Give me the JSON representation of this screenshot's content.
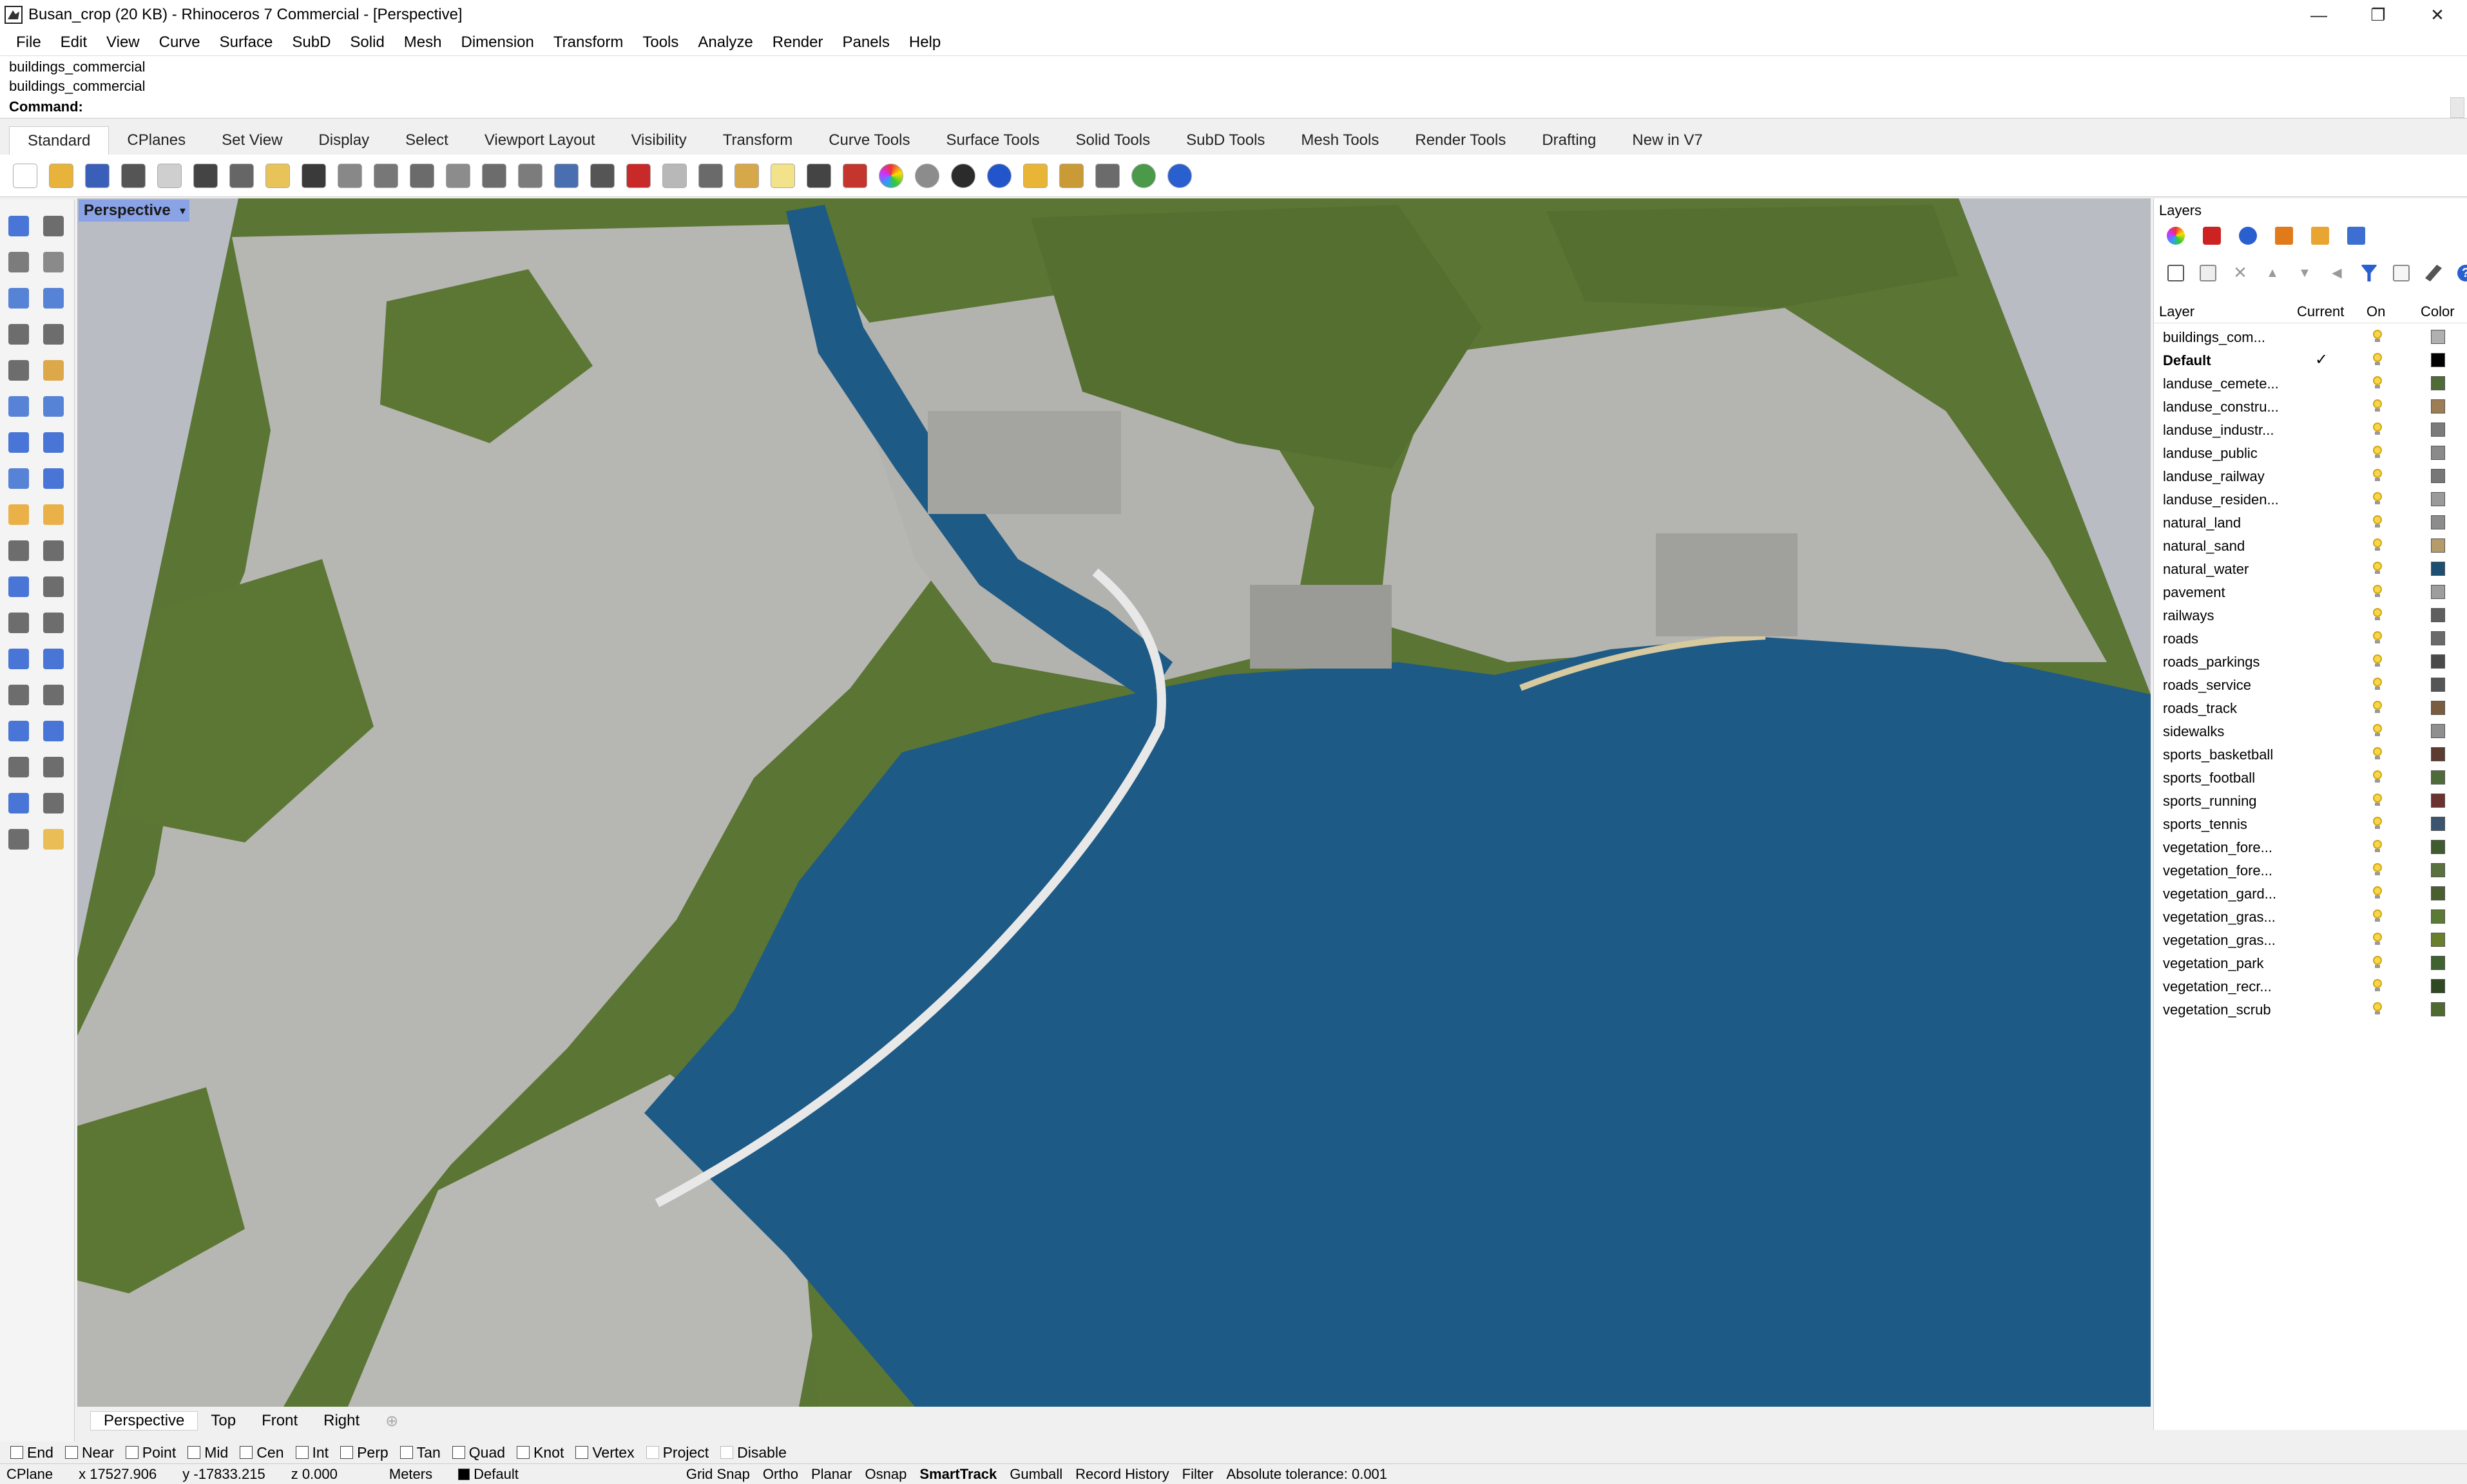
{
  "window": {
    "title": "Busan_crop (20 KB) - Rhinoceros 7 Commercial - [Perspective]",
    "minimize": "—",
    "maximize": "❐",
    "close": "✕"
  },
  "menu": [
    "File",
    "Edit",
    "View",
    "Curve",
    "Surface",
    "SubD",
    "Solid",
    "Mesh",
    "Dimension",
    "Transform",
    "Tools",
    "Analyze",
    "Render",
    "Panels",
    "Help"
  ],
  "command": {
    "history": [
      "buildings_commercial",
      "buildings_commercial"
    ],
    "prompt": "Command:",
    "value": ""
  },
  "toolbar_tabs": [
    "Standard",
    "CPlanes",
    "Set View",
    "Display",
    "Select",
    "Viewport Layout",
    "Visibility",
    "Transform",
    "Curve Tools",
    "Surface Tools",
    "Solid Tools",
    "SubD Tools",
    "Mesh Tools",
    "Render Tools",
    "Drafting",
    "New in V7"
  ],
  "toolbar_icons": [
    "new-file-icon",
    "open-file-icon",
    "save-icon",
    "print-icon",
    "import-icon",
    "cut-icon",
    "copy-icon",
    "paste-icon",
    "undo-icon",
    "pan-icon",
    "rotate-view-icon",
    "zoom-icon",
    "zoom-window-icon",
    "zoom-extents-icon",
    "zoom-selected-icon",
    "undo-view-icon",
    "four-viewports-icon",
    "car-icon",
    "tilt-icon",
    "properties-icon",
    "select-filter-icon",
    "light-icon",
    "lock-icon",
    "layer-icon",
    "color-wheel-icon",
    "shade-icon",
    "render-preview-icon",
    "render-icon",
    "named-view-icon",
    "options-icon",
    "grid-icon",
    "globe-icon",
    "help-icon"
  ],
  "viewport": {
    "label": "Perspective",
    "tabs": [
      "Perspective",
      "Top",
      "Front",
      "Right"
    ]
  },
  "layers_panel": {
    "title": "Layers",
    "columns": {
      "layer": "Layer",
      "current": "Current",
      "on": "On",
      "color": "Color"
    },
    "layers": [
      {
        "name": "buildings_com...",
        "current": "",
        "color": "#b0b0b0"
      },
      {
        "name": "Default",
        "current": "✓",
        "color": "#000000"
      },
      {
        "name": "landuse_cemete...",
        "current": "",
        "color": "#4f6b3a"
      },
      {
        "name": "landuse_constru...",
        "current": "",
        "color": "#9c7d55"
      },
      {
        "name": "landuse_industr...",
        "current": "",
        "color": "#7b7b7b"
      },
      {
        "name": "landuse_public",
        "current": "",
        "color": "#8a8a8a"
      },
      {
        "name": "landuse_railway",
        "current": "",
        "color": "#777777"
      },
      {
        "name": "landuse_residen...",
        "current": "",
        "color": "#9a9a9a"
      },
      {
        "name": "natural_land",
        "current": "",
        "color": "#8c8c8c"
      },
      {
        "name": "natural_sand",
        "current": "",
        "color": "#b59a6a"
      },
      {
        "name": "natural_water",
        "current": "",
        "color": "#1c4f72"
      },
      {
        "name": "pavement",
        "current": "",
        "color": "#9d9d9d"
      },
      {
        "name": "railways",
        "current": "",
        "color": "#5f5f5f"
      },
      {
        "name": "roads",
        "current": "",
        "color": "#6a6a6a"
      },
      {
        "name": "roads_parkings",
        "current": "",
        "color": "#4a4a4a"
      },
      {
        "name": "roads_service",
        "current": "",
        "color": "#555555"
      },
      {
        "name": "roads_track",
        "current": "",
        "color": "#7a5d40"
      },
      {
        "name": "sidewalks",
        "current": "",
        "color": "#8f8f8f"
      },
      {
        "name": "sports_basketball",
        "current": "",
        "color": "#5e3b30"
      },
      {
        "name": "sports_football",
        "current": "",
        "color": "#4f6b3a"
      },
      {
        "name": "sports_running",
        "current": "",
        "color": "#6b3330"
      },
      {
        "name": "sports_tennis",
        "current": "",
        "color": "#3b5470"
      },
      {
        "name": "vegetation_fore...",
        "current": "",
        "color": "#3f5c2f"
      },
      {
        "name": "vegetation_fore...",
        "current": "",
        "color": "#58713e"
      },
      {
        "name": "vegetation_gard...",
        "current": "",
        "color": "#4a5f30"
      },
      {
        "name": "vegetation_gras...",
        "current": "",
        "color": "#5a7a35"
      },
      {
        "name": "vegetation_gras...",
        "current": "",
        "color": "#6a7f2e"
      },
      {
        "name": "vegetation_park",
        "current": "",
        "color": "#3f6230"
      },
      {
        "name": "vegetation_recr...",
        "current": "",
        "color": "#2f4a22"
      },
      {
        "name": "vegetation_scrub",
        "current": "",
        "color": "#4f6a30"
      }
    ]
  },
  "osnap": [
    {
      "label": "End",
      "checked": false
    },
    {
      "label": "Near",
      "checked": false
    },
    {
      "label": "Point",
      "checked": false
    },
    {
      "label": "Mid",
      "checked": false
    },
    {
      "label": "Cen",
      "checked": false
    },
    {
      "label": "Int",
      "checked": false
    },
    {
      "label": "Perp",
      "checked": false
    },
    {
      "label": "Tan",
      "checked": false
    },
    {
      "label": "Quad",
      "checked": false
    },
    {
      "label": "Knot",
      "checked": false
    },
    {
      "label": "Vertex",
      "checked": false
    },
    {
      "label": "Project",
      "checked": false
    },
    {
      "label": "Disable",
      "checked": false
    }
  ],
  "status": {
    "cplane": "CPlane",
    "x": "x 17527.906",
    "y": "y -17833.215",
    "z": "z 0.000",
    "units": "Meters",
    "layer": "Default",
    "layer_color": "#000000",
    "toggles": [
      "Grid Snap",
      "Ortho",
      "Planar",
      "Osnap",
      "SmartTrack",
      "Gumball",
      "Record History",
      "Filter"
    ],
    "active_toggle": "SmartTrack",
    "tolerance": "Absolute tolerance: 0.001"
  },
  "colors": {
    "water": "#1d5a85",
    "terrain_green": "#5a7534",
    "city_gray": "#b6b6b2",
    "viewport_bg": "#b9bcc3",
    "viewport_label_bg": "#8aa3e6"
  }
}
